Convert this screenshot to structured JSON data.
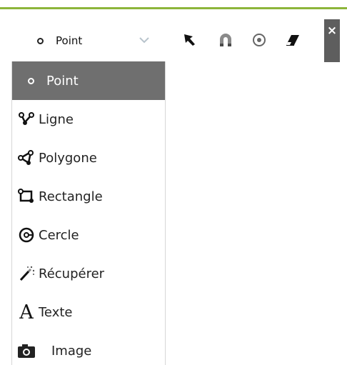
{
  "toolbar": {
    "selected_label": "Point",
    "tools": [
      {
        "name": "select-arrow-icon"
      },
      {
        "name": "magnet-snap-icon"
      },
      {
        "name": "target-circle-icon"
      },
      {
        "name": "eraser-icon"
      }
    ],
    "close_label": "×"
  },
  "menu": {
    "items": [
      {
        "label": "Point",
        "icon": "point-dot-icon",
        "selected": true
      },
      {
        "label": "Ligne",
        "icon": "line-draw-icon"
      },
      {
        "label": "Polygone",
        "icon": "polygon-draw-icon"
      },
      {
        "label": "Rectangle",
        "icon": "rectangle-draw-icon"
      },
      {
        "label": "Cercle",
        "icon": "circle-draw-icon"
      },
      {
        "label": "Récupérer",
        "icon": "magic-wand-icon"
      },
      {
        "label": "Texte",
        "icon": "text-A-icon"
      },
      {
        "label": "Image",
        "icon": "camera-icon"
      }
    ]
  },
  "colors": {
    "accent_line": "#8cb53a",
    "selected_bg": "#6f6f6f",
    "close_bg": "#5e5e5e"
  }
}
